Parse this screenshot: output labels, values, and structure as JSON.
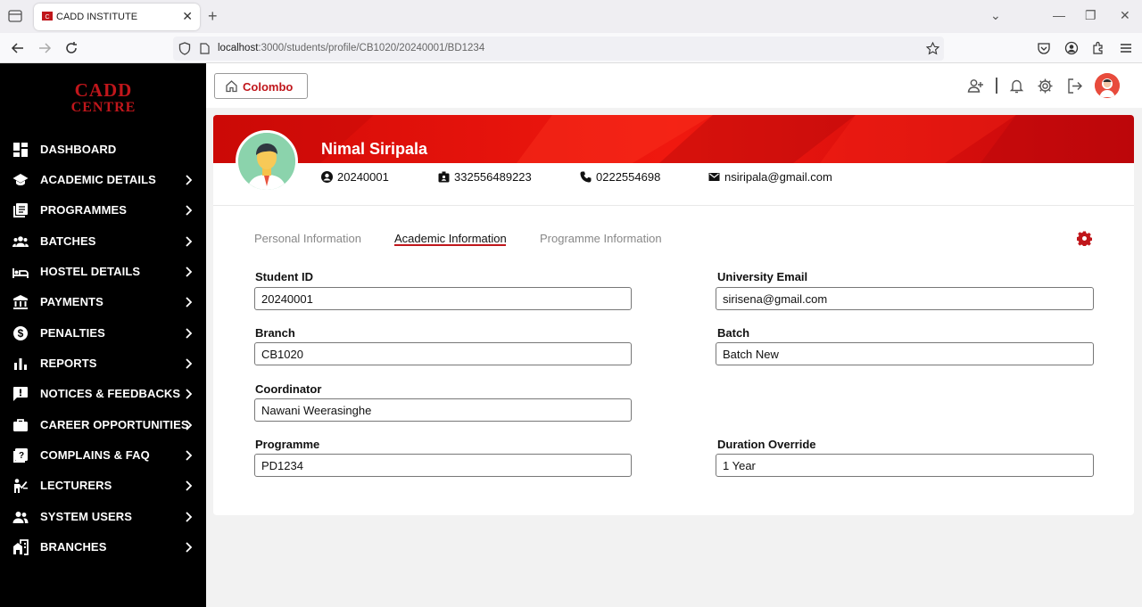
{
  "browser": {
    "tab_title": "CADD INSTITUTE",
    "url_host": "localhost",
    "url_path": ":3000/students/profile/CB1020/20240001/BD1234"
  },
  "sidebar": {
    "logo_line1": "CADD",
    "logo_line2": "CENTRE",
    "items": [
      {
        "label": "DASHBOARD",
        "icon": "dashboard-icon",
        "chevron": false
      },
      {
        "label": "ACADEMIC DETAILS",
        "icon": "graduation-cap-icon",
        "chevron": true
      },
      {
        "label": "PROGRAMMES",
        "icon": "library-books-icon",
        "chevron": true
      },
      {
        "label": "BATCHES",
        "icon": "group-icon",
        "chevron": true
      },
      {
        "label": "HOSTEL DETAILS",
        "icon": "bed-icon",
        "chevron": true
      },
      {
        "label": "PAYMENTS",
        "icon": "bank-icon",
        "chevron": true
      },
      {
        "label": "PENALTIES",
        "icon": "dollar-circle-icon",
        "chevron": true
      },
      {
        "label": "REPORTS",
        "icon": "bar-chart-icon",
        "chevron": true
      },
      {
        "label": "NOTICES & FEEDBACKS",
        "icon": "feedback-icon",
        "chevron": true
      },
      {
        "label": "CAREER OPPORTUNITIES",
        "icon": "briefcase-icon",
        "chevron": true
      },
      {
        "label": "COMPLAINS & FAQ",
        "icon": "help-center-icon",
        "chevron": true
      },
      {
        "label": "LECTURERS",
        "icon": "lecturer-icon",
        "chevron": true
      },
      {
        "label": "SYSTEM USERS",
        "icon": "users-icon",
        "chevron": true
      },
      {
        "label": "BRANCHES",
        "icon": "branches-icon",
        "chevron": true
      }
    ]
  },
  "topbar": {
    "branch_label": "Colombo"
  },
  "profile": {
    "name": "Nimal Siripala",
    "student_no": "20240001",
    "nic": "332556489223",
    "phone": "0222554698",
    "email": "nsiripala@gmail.com"
  },
  "tabs": [
    {
      "label": "Personal Information",
      "active": false
    },
    {
      "label": "Academic Information",
      "active": true
    },
    {
      "label": "Programme Information",
      "active": false
    }
  ],
  "form": {
    "student_id": {
      "label": "Student ID",
      "value": "20240001"
    },
    "university_email": {
      "label": "University Email",
      "value": "sirisena@gmail.com"
    },
    "branch": {
      "label": "Branch",
      "value": "CB1020"
    },
    "batch": {
      "label": "Batch",
      "value": "Batch New"
    },
    "coordinator": {
      "label": "Coordinator",
      "value": "Nawani Weerasinghe"
    },
    "programme": {
      "label": "Programme",
      "value": "PD1234"
    },
    "duration_override": {
      "label": "Duration Override",
      "value": "1 Year"
    }
  },
  "colors": {
    "accent": "#c0161b",
    "sidebar_bg": "#000000",
    "banner_red": "#e0120e"
  }
}
